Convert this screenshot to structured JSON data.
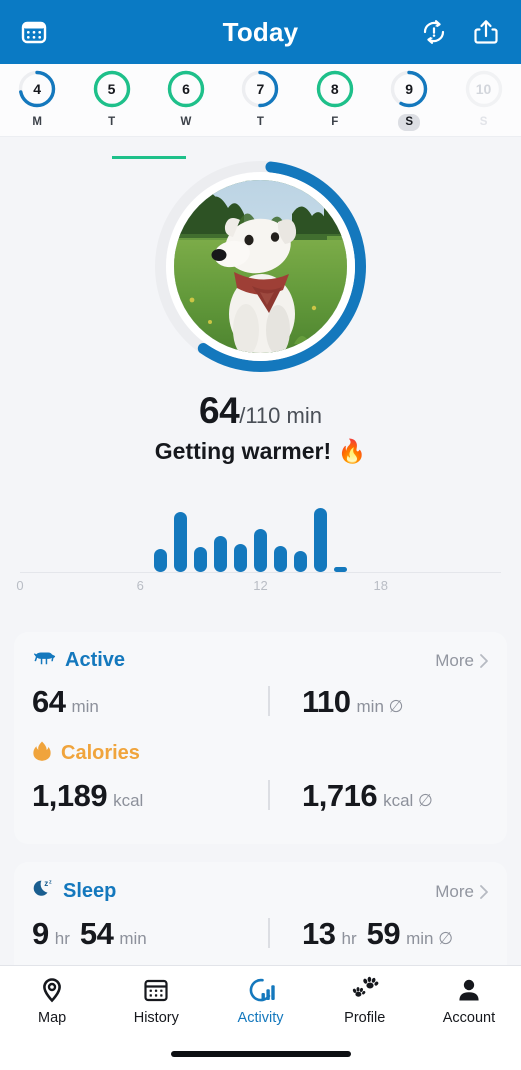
{
  "header": {
    "title": "Today",
    "calendar_icon": "calendar-icon",
    "sync_icon": "sync-alert-icon",
    "share_icon": "share-icon",
    "background_color": "#0a7ac4"
  },
  "day_strip": {
    "days": [
      {
        "num": "4",
        "label": "M",
        "ring": "blue",
        "progress": 72,
        "selected": false,
        "future": false
      },
      {
        "num": "5",
        "label": "T",
        "ring": "green",
        "progress": 100,
        "selected": false,
        "future": false
      },
      {
        "num": "6",
        "label": "W",
        "ring": "green",
        "progress": 100,
        "selected": false,
        "future": false
      },
      {
        "num": "7",
        "label": "T",
        "ring": "blue",
        "progress": 50,
        "selected": false,
        "future": false
      },
      {
        "num": "8",
        "label": "F",
        "ring": "green",
        "progress": 100,
        "selected": false,
        "future": false
      },
      {
        "num": "9",
        "label": "S",
        "ring": "blue",
        "progress": 58,
        "selected": true,
        "future": false
      },
      {
        "num": "10",
        "label": "S",
        "ring": "none",
        "progress": 0,
        "selected": false,
        "future": true
      }
    ],
    "streak_color": "#1ec08a",
    "ring_blue": "#1478bd",
    "ring_green": "#1ec08a",
    "ring_track": "#edeef1"
  },
  "hero": {
    "avatar_alt": "dog-photo",
    "progress_percent": 58,
    "progress_color": "#1478bd",
    "value": "64",
    "goal": "/110 min",
    "message": "Getting warmer! 🔥"
  },
  "chart_data": {
    "type": "bar",
    "title": "",
    "xlabel": "",
    "ylabel": "",
    "x": [
      7,
      8,
      9,
      10,
      11,
      12,
      13,
      14,
      15,
      16
    ],
    "categories": [
      "7",
      "8",
      "9",
      "10",
      "11",
      "12",
      "13",
      "14",
      "15",
      "16"
    ],
    "values": [
      6,
      16,
      6.5,
      9.5,
      7.5,
      11.5,
      7,
      5.5,
      17,
      1
    ],
    "xlim": [
      0,
      24
    ],
    "ylim": [
      0,
      18
    ],
    "xticks": [
      0,
      6,
      12,
      18
    ],
    "xtick_labels": [
      "0",
      "6",
      "12",
      "18"
    ],
    "grid": false,
    "bar_color": "#1478bd",
    "axis_color": "#e4e6eb",
    "tick_label_color": "#b9bdc5"
  },
  "cards": [
    {
      "id": "activity-card",
      "rows": [
        {
          "id": "active",
          "icon": "dog-icon",
          "title": "Active",
          "title_color": "#1478bd",
          "more_label": "More",
          "primary_value": "64",
          "primary_unit": "min",
          "secondary_value": "110",
          "secondary_unit": "min ∅"
        },
        {
          "id": "calories",
          "icon": "flame-icon",
          "title": "Calories",
          "title_color": "#f0a43c",
          "more_label": "",
          "primary_value": "1,189",
          "primary_unit": "kcal",
          "secondary_value": "1,716",
          "secondary_unit": "kcal ∅"
        }
      ]
    },
    {
      "id": "sleep-card",
      "rows": [
        {
          "id": "sleep",
          "icon": "moon-z-icon",
          "title": "Sleep",
          "title_color": "#1478bd",
          "more_label": "More",
          "primary_value": "9",
          "primary_unit": "hr",
          "primary_value2": "54",
          "primary_unit2": "min",
          "secondary_value": "13",
          "secondary_unit": "hr",
          "secondary_value2": "59",
          "secondary_unit2": "min ∅"
        }
      ]
    }
  ],
  "tabbar": {
    "tabs": [
      {
        "label": "Map",
        "icon": "map-pin-icon",
        "active": false
      },
      {
        "label": "History",
        "icon": "calendar-icon",
        "active": false
      },
      {
        "label": "Activity",
        "icon": "activity-chart-icon",
        "active": true
      },
      {
        "label": "Profile",
        "icon": "paw-prints-icon",
        "active": false
      },
      {
        "label": "Account",
        "icon": "person-icon",
        "active": false
      }
    ],
    "active_color": "#1478bd",
    "inactive_color": "#16181d"
  }
}
